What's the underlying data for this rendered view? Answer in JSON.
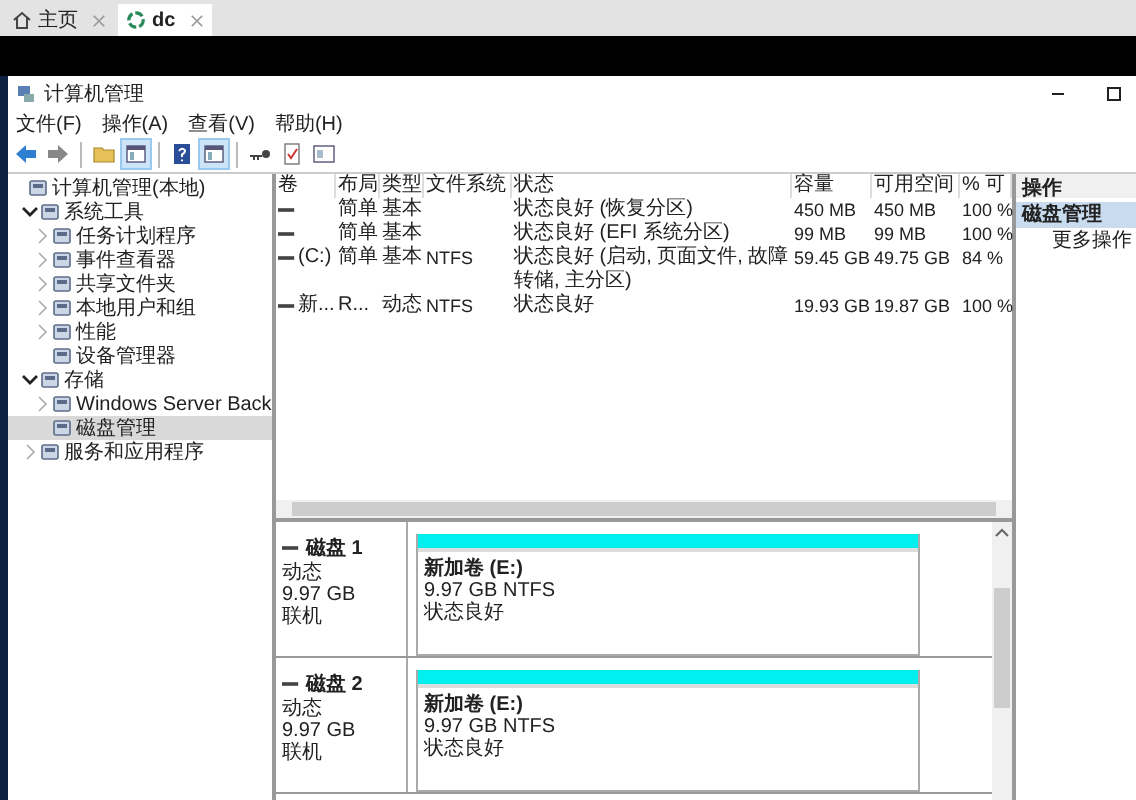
{
  "browser_tabs": [
    {
      "label": "主页",
      "kind": "home",
      "selected": false
    },
    {
      "label": "dc",
      "kind": "vm",
      "selected": true
    }
  ],
  "window": {
    "title": "计算机管理"
  },
  "menu": [
    "文件(F)",
    "操作(A)",
    "查看(V)",
    "帮助(H)"
  ],
  "toolbar": [
    {
      "kind": "back",
      "pressed": false
    },
    {
      "kind": "forward",
      "pressed": false
    },
    {
      "kind": "sep"
    },
    {
      "kind": "folder",
      "pressed": false
    },
    {
      "kind": "pane",
      "pressed": true
    },
    {
      "kind": "sep"
    },
    {
      "kind": "help",
      "pressed": false
    },
    {
      "kind": "pane",
      "pressed": true
    },
    {
      "kind": "sep"
    },
    {
      "kind": "key",
      "pressed": false
    },
    {
      "kind": "doc",
      "pressed": false
    },
    {
      "kind": "window",
      "pressed": false
    }
  ],
  "tree": [
    {
      "label": "计算机管理(本地)",
      "expandable": false,
      "selected": false,
      "children": [
        {
          "label": "系统工具",
          "expandable": true,
          "expanded": true,
          "selected": false,
          "children": [
            {
              "label": "任务计划程序",
              "expandable": true,
              "expanded": false,
              "selected": false
            },
            {
              "label": "事件查看器",
              "expandable": true,
              "expanded": false,
              "selected": false
            },
            {
              "label": "共享文件夹",
              "expandable": true,
              "expanded": false,
              "selected": false
            },
            {
              "label": "本地用户和组",
              "expandable": true,
              "expanded": false,
              "selected": false
            },
            {
              "label": "性能",
              "expandable": true,
              "expanded": false,
              "selected": false
            },
            {
              "label": "设备管理器",
              "expandable": false,
              "selected": false
            }
          ]
        },
        {
          "label": "存储",
          "expandable": true,
          "expanded": true,
          "selected": false,
          "children": [
            {
              "label": "Windows Server Back",
              "expandable": true,
              "expanded": false,
              "selected": false
            },
            {
              "label": "磁盘管理",
              "expandable": false,
              "selected": true
            }
          ]
        },
        {
          "label": "服务和应用程序",
          "expandable": true,
          "expanded": false,
          "selected": false
        }
      ]
    }
  ],
  "volume_table": {
    "columns": [
      "卷",
      "布局",
      "类型",
      "文件系统",
      "状态",
      "容量",
      "可用空间",
      "% 可"
    ],
    "rows": [
      {
        "volume": "",
        "layout": "简单",
        "type": "基本",
        "fs": "",
        "status": "状态良好 (恢复分区)",
        "capacity": "450 MB",
        "free": "450 MB",
        "pct": "100 %"
      },
      {
        "volume": "",
        "layout": "简单",
        "type": "基本",
        "fs": "",
        "status": "状态良好 (EFI 系统分区)",
        "capacity": "99 MB",
        "free": "99 MB",
        "pct": "100 %"
      },
      {
        "volume": "(C:)",
        "layout": "简单",
        "type": "基本",
        "fs": "NTFS",
        "status": "状态良好 (启动, 页面文件, 故障转储, 主分区)",
        "capacity": "59.45 GB",
        "free": "49.75 GB",
        "pct": "84 %"
      },
      {
        "volume": "新...",
        "layout": "R...",
        "type": "动态",
        "fs": "NTFS",
        "status": "状态良好",
        "capacity": "19.93 GB",
        "free": "19.87 GB",
        "pct": "100 %"
      }
    ]
  },
  "disks": [
    {
      "name": "磁盘 1",
      "type": "动态",
      "size": "9.97 GB",
      "state": "联机",
      "volume": {
        "name": "新加卷 (E:)",
        "detail": "9.97 GB NTFS",
        "status": "状态良好"
      }
    },
    {
      "name": "磁盘 2",
      "type": "动态",
      "size": "9.97 GB",
      "state": "联机",
      "volume": {
        "name": "新加卷 (E:)",
        "detail": "9.97 GB NTFS",
        "status": "状态良好"
      }
    }
  ],
  "actions": {
    "header": "操作",
    "items": [
      {
        "label": "磁盘管理",
        "selected": true
      },
      {
        "label": "更多操作",
        "selected": false
      }
    ]
  }
}
